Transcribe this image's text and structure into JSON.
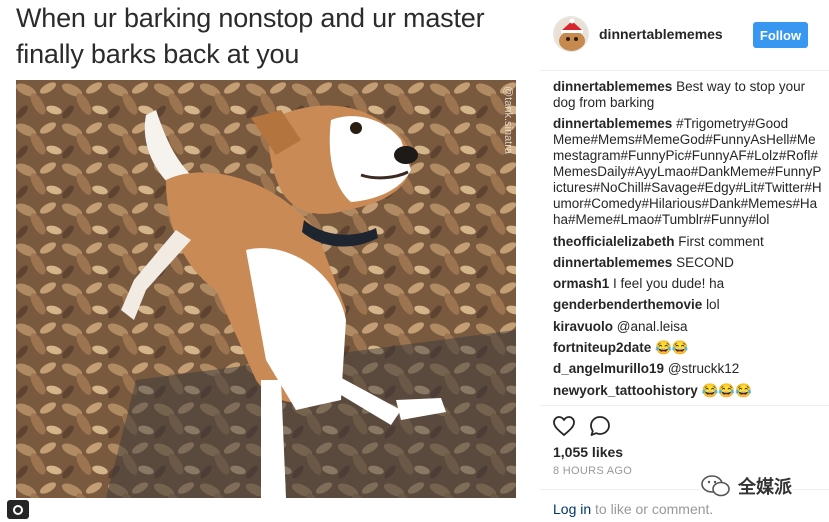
{
  "meme": {
    "caption_line1": "When ur barking nonstop and ur master",
    "caption_line2": "finally barks back at you",
    "watermark": "@tank.sinatra"
  },
  "post": {
    "username": "dinnertablememes",
    "follow_label": "Follow",
    "comments": [
      {
        "author": "dinnertablememes",
        "text": "Best way to stop your dog from barking",
        "kind": "text"
      },
      {
        "author": "dinnertablememes",
        "text": "#Trigometry#Good Meme#Mems#MemeGod#FunnyAsHell#Memestagram#FunnyPic#FunnyAF#Lolz#Rofl#MemesDaily#AyyLmao#DankMeme#FunnyPictures#NoChill#Savage#Edgy#Lit#Twitter#Humor#Comedy#Hilarious#Dank#Memes#Haha#Meme#Lmao#Tumblr#Funny#lol",
        "kind": "hashtags"
      },
      {
        "author": "theofficialelizabeth",
        "text": "First comment",
        "kind": "text"
      },
      {
        "author": "dinnertablememes",
        "text": "SECOND",
        "kind": "text"
      },
      {
        "author": "ormash1",
        "text": "I feel you dude! ha",
        "kind": "text"
      },
      {
        "author": "genderbenderthemovie",
        "text": "lol",
        "kind": "text"
      },
      {
        "author": "kiravuolo",
        "text": "@anal.leisa",
        "kind": "mention"
      },
      {
        "author": "fortniteup2date",
        "text": "😂😂",
        "kind": "text"
      },
      {
        "author": "d_angelmurillo19",
        "text": "@struckk12",
        "kind": "mention"
      },
      {
        "author": "newyork_tattoohistory",
        "text": "😂😂😂",
        "kind": "text"
      }
    ],
    "likes": "1,055 likes",
    "timestamp": "8 HOURS AGO",
    "login_link": "Log in",
    "login_rest": " to like or comment."
  },
  "overlay": {
    "brand": "全媒派"
  },
  "icons": {
    "like": "heart-icon",
    "comment": "comment-bubble-icon",
    "options": "more-options-icon",
    "instagram": "instagram-glyph-icon",
    "brand": "wechat-brand-icon"
  },
  "colors": {
    "follow_button": "#3897f0",
    "link": "#003569",
    "muted": "#999999"
  }
}
